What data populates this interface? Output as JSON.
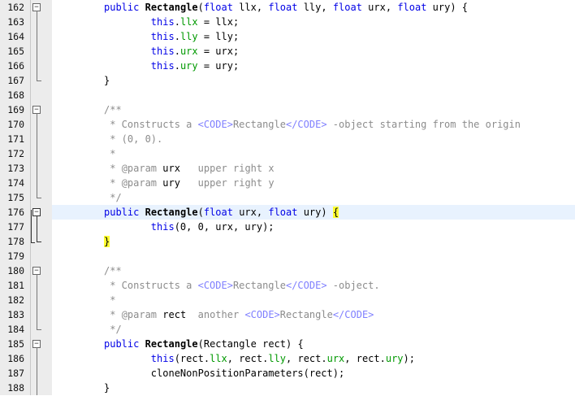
{
  "editor": {
    "lines": [
      {
        "num": "162",
        "fold": "open"
      },
      {
        "num": "163",
        "fold": "line"
      },
      {
        "num": "164",
        "fold": "line"
      },
      {
        "num": "165",
        "fold": "line"
      },
      {
        "num": "166",
        "fold": "line"
      },
      {
        "num": "167",
        "fold": "end"
      },
      {
        "num": "168",
        "fold": ""
      },
      {
        "num": "169",
        "fold": "open"
      },
      {
        "num": "170",
        "fold": "line"
      },
      {
        "num": "171",
        "fold": "line"
      },
      {
        "num": "172",
        "fold": "line"
      },
      {
        "num": "173",
        "fold": "line"
      },
      {
        "num": "174",
        "fold": "line"
      },
      {
        "num": "175",
        "fold": "end"
      },
      {
        "num": "176",
        "fold": "open-active"
      },
      {
        "num": "177",
        "fold": "line-active"
      },
      {
        "num": "178",
        "fold": "end-active"
      },
      {
        "num": "179",
        "fold": ""
      },
      {
        "num": "180",
        "fold": "open"
      },
      {
        "num": "181",
        "fold": "line"
      },
      {
        "num": "182",
        "fold": "line"
      },
      {
        "num": "183",
        "fold": "line"
      },
      {
        "num": "184",
        "fold": "end"
      },
      {
        "num": "185",
        "fold": "open"
      },
      {
        "num": "186",
        "fold": "line"
      },
      {
        "num": "187",
        "fold": "line"
      },
      {
        "num": "188",
        "fold": "line"
      }
    ],
    "code": {
      "l162": {
        "kw1": "public",
        "name": "Rectangle",
        "p1": "(",
        "t1": "float",
        "a1": " llx, ",
        "t2": "float",
        "a2": " lly, ",
        "t3": "float",
        "a3": " urx, ",
        "t4": "float",
        "a4": " ury) {"
      },
      "l163": {
        "this": "this",
        "dot": ".",
        "f": "llx",
        "rest": " = llx;"
      },
      "l164": {
        "this": "this",
        "dot": ".",
        "f": "lly",
        "rest": " = lly;"
      },
      "l165": {
        "this": "this",
        "dot": ".",
        "f": "urx",
        "rest": " = urx;"
      },
      "l166": {
        "this": "this",
        "dot": ".",
        "f": "ury",
        "rest": " = ury;"
      },
      "l167": {
        "t": "}"
      },
      "l169": {
        "t": "/**"
      },
      "l170": {
        "c1": " * Constructs a ",
        "tg1": "<CODE>",
        "c2": "Rectangle",
        "tg2": "</CODE>",
        "c3": " -object starting from the origin"
      },
      "l171": {
        "t": " * (0, 0)."
      },
      "l172": {
        "t": " *"
      },
      "l173": {
        "pre": " * ",
        "tag": "@param",
        "sp": " ",
        "name": "urx",
        "desc": "   upper right x"
      },
      "l174": {
        "pre": " * ",
        "tag": "@param",
        "sp": " ",
        "name": "ury",
        "desc": "   upper right y"
      },
      "l175": {
        "t": " */"
      },
      "l176": {
        "kw1": "public",
        "name": "Rectangle",
        "p1": "(",
        "t1": "float",
        "a1": " urx, ",
        "t2": "float",
        "a2": " ury) ",
        "brace": "{"
      },
      "l177": {
        "this": "this",
        "rest": "(0, 0, urx, ury);"
      },
      "l178": {
        "brace": "}"
      },
      "l180": {
        "t": "/**"
      },
      "l181": {
        "c1": " * Constructs a ",
        "tg1": "<CODE>",
        "c2": "Rectangle",
        "tg2": "</CODE>",
        "c3": " -object."
      },
      "l182": {
        "t": " *"
      },
      "l183": {
        "pre": " * ",
        "tag": "@param",
        "sp": " ",
        "name": "rect",
        "desc": "  another ",
        "tg1": "<CODE>",
        "c2": "Rectangle",
        "tg2": "</CODE>"
      },
      "l184": {
        "t": " */"
      },
      "l185": {
        "kw1": "public",
        "name": "Rectangle",
        "rest": "(Rectangle rect) {"
      },
      "l186": {
        "this": "this",
        "p": "(rect.",
        "f1": "llx",
        "s1": ", rect.",
        "f2": "lly",
        "s2": ", rect.",
        "f3": "urx",
        "s3": ", rect.",
        "f4": "ury",
        "end": ");"
      },
      "l187": {
        "t": "cloneNonPositionParameters(rect);"
      },
      "l188": {
        "t": "}"
      }
    }
  }
}
